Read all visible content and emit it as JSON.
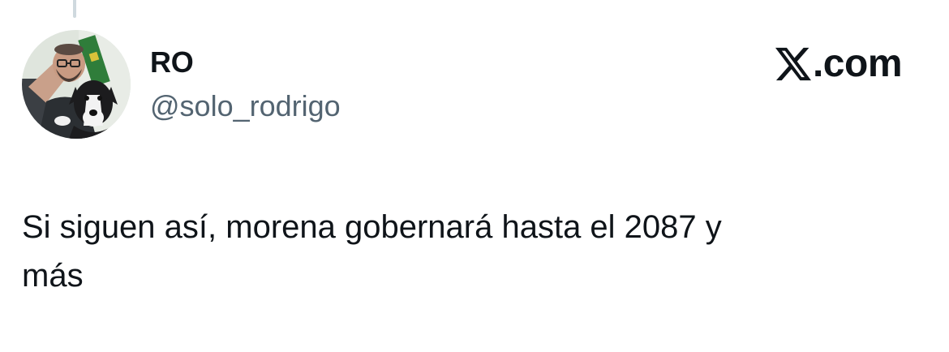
{
  "tweet": {
    "author": {
      "display_name": "RO",
      "handle": "@solo_rodrigo",
      "avatar_icon": "profile-photo-man-with-dog"
    },
    "brand": {
      "logo_icon": "x-logo-icon",
      "text": ".com"
    },
    "text_line_1": "Si siguen así, morena gobernará hasta el 2087 y",
    "text_line_2": "más"
  },
  "colors": {
    "text_primary": "#0f1419",
    "text_secondary": "#536471",
    "thread_line": "#cfd9de",
    "background": "#ffffff"
  }
}
